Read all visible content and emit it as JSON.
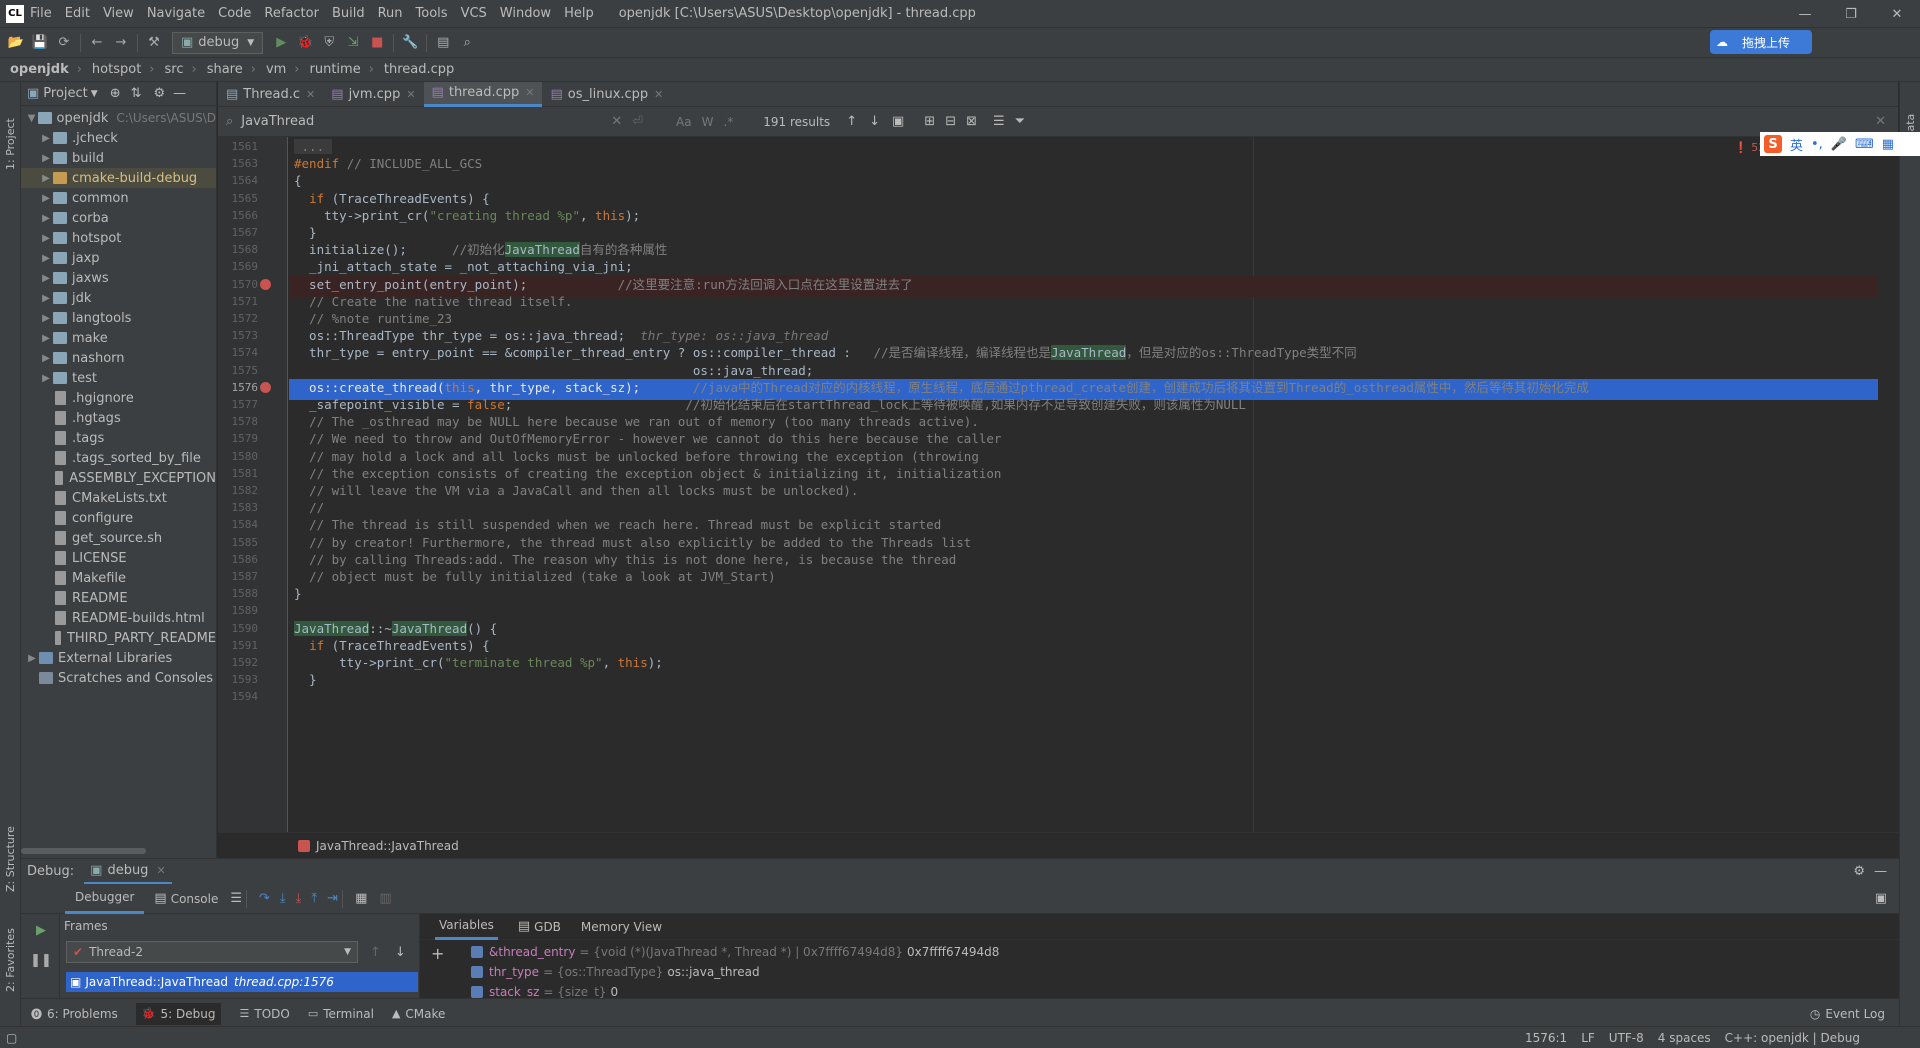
{
  "app": {
    "logo": "CL",
    "title": "openjdk [C:\\Users\\ASUS\\Desktop\\openjdk] - thread.cpp"
  },
  "menu": [
    "File",
    "Edit",
    "View",
    "Navigate",
    "Code",
    "Refactor",
    "Build",
    "Run",
    "Tools",
    "VCS",
    "Window",
    "Help"
  ],
  "toolbar": {
    "config": "debug"
  },
  "baidu": {
    "label": "拖拽上传"
  },
  "breadcrumb": [
    "openjdk",
    "hotspot",
    "src",
    "share",
    "vm",
    "runtime",
    "thread.cpp"
  ],
  "project": {
    "header": "Project",
    "root": {
      "name": "openjdk",
      "path": "C:\\Users\\ASUS\\D"
    },
    "items": [
      {
        "name": ".jcheck",
        "type": "folder"
      },
      {
        "name": "build",
        "type": "folder"
      },
      {
        "name": "cmake-build-debug",
        "type": "folder",
        "selected": true
      },
      {
        "name": "common",
        "type": "folder"
      },
      {
        "name": "corba",
        "type": "folder"
      },
      {
        "name": "hotspot",
        "type": "folder"
      },
      {
        "name": "jaxp",
        "type": "folder"
      },
      {
        "name": "jaxws",
        "type": "folder"
      },
      {
        "name": "jdk",
        "type": "folder"
      },
      {
        "name": "langtools",
        "type": "folder"
      },
      {
        "name": "make",
        "type": "folder"
      },
      {
        "name": "nashorn",
        "type": "folder"
      },
      {
        "name": "test",
        "type": "folder"
      },
      {
        "name": ".hgignore",
        "type": "file"
      },
      {
        "name": ".hgtags",
        "type": "file"
      },
      {
        "name": ".tags",
        "type": "file"
      },
      {
        "name": ".tags_sorted_by_file",
        "type": "file"
      },
      {
        "name": "ASSEMBLY_EXCEPTION",
        "type": "file"
      },
      {
        "name": "CMakeLists.txt",
        "type": "file"
      },
      {
        "name": "configure",
        "type": "file"
      },
      {
        "name": "get_source.sh",
        "type": "file"
      },
      {
        "name": "LICENSE",
        "type": "file"
      },
      {
        "name": "Makefile",
        "type": "file"
      },
      {
        "name": "README",
        "type": "file"
      },
      {
        "name": "README-builds.html",
        "type": "file"
      },
      {
        "name": "THIRD_PARTY_README",
        "type": "file"
      }
    ],
    "external": "External Libraries",
    "scratches": "Scratches and Consoles"
  },
  "tabs": [
    "Thread.c",
    "jvm.cpp",
    "thread.cpp",
    "os_linux.cpp"
  ],
  "active_tab": 2,
  "search": {
    "query": "JavaThread",
    "results": "191 results",
    "opt_case": "Aa",
    "opt_word": "W",
    "opt_regex": ".*"
  },
  "editor": {
    "errors": "52",
    "lines": [
      {
        "n": "1561",
        "html": "<span class='cm' style='background:#3b3b3b'> ... </span>"
      },
      {
        "n": "1563",
        "html": "<span class='kw'>#endif</span> <span class='cm'>// INCLUDE_ALL_GCS</span>"
      },
      {
        "n": "1564",
        "html": "{"
      },
      {
        "n": "1565",
        "html": "  <span class='kw'>if</span> (TraceThreadEvents) {"
      },
      {
        "n": "1566",
        "html": "    tty-&gt;print_cr(<span class='str'>\"creating thread %p\"</span>, <span class='kw'>this</span>);"
      },
      {
        "n": "1567",
        "html": "  }"
      },
      {
        "n": "1568",
        "html": "  initialize();      <span class='cm'>//初始化<span class='hl'>JavaThread</span>自有的各种属性</span>"
      },
      {
        "n": "1569",
        "html": "  _jni_attach_state = _not_attaching_via_jni;"
      },
      {
        "n": "1570",
        "html": "  set_entry_point(entry_point);            <span class='cm'>//这里要注意:run方法回调入口点在这里设置进去了</span>",
        "bp": true,
        "band": "#3a2323"
      },
      {
        "n": "1571",
        "html": "  <span class='cm'>// Create the native thread itself.</span>"
      },
      {
        "n": "1572",
        "html": "  <span class='cm'>// %note runtime_23</span>"
      },
      {
        "n": "1573",
        "html": "  os::ThreadType thr_type = os::java_thread;  <span class='hint'>thr_type: os::java_thread</span>"
      },
      {
        "n": "1574",
        "html": "  thr_type = entry_point == &amp;compiler_thread_entry ? os::compiler_thread :   <span class='cm'>//是否编译线程，编译线程也是<span class='hl'>JavaThread</span>，但是对应的os::ThreadType类型不同</span>"
      },
      {
        "n": "1575",
        "html": "                                                     os::java_thread;"
      },
      {
        "n": "1576",
        "html": "  os::create_thread(<span class='kw'>this</span>, thr_type, stack_sz);       <span class='cm'>//java中的Thread对应的内核线程，原生线程，底层通过pthread_create创建，创建成功后将其设置到Thread的_osthread属性中，然后等待其初始化完成</span>",
        "bp": true,
        "band": "#2f65ca"
      },
      {
        "n": "1577",
        "html": "  _safepoint_visible = <span class='kw'>false</span>;                       <span class='cm'>//初始化结束后在startThread_lock上等待被唤醒,如果内存不足导致创建失败，则该属性为NULL</span>"
      },
      {
        "n": "1578",
        "html": "  <span class='cm'>// The _osthread may be NULL here because we ran out of memory (too many threads active).</span>"
      },
      {
        "n": "1579",
        "html": "  <span class='cm'>// We need to throw and OutOfMemoryError - however we cannot do this here because the caller</span>"
      },
      {
        "n": "1580",
        "html": "  <span class='cm'>// may hold a lock and all locks must be unlocked before throwing the exception (throwing</span>"
      },
      {
        "n": "1581",
        "html": "  <span class='cm'>// the exception consists of creating the exception object &amp; initializing it, initialization</span>"
      },
      {
        "n": "1582",
        "html": "  <span class='cm'>// will leave the VM via a JavaCall and then all locks must be unlocked).</span>"
      },
      {
        "n": "1583",
        "html": "  <span class='cm'>//</span>"
      },
      {
        "n": "1584",
        "html": "  <span class='cm'>// The thread is still suspended when we reach here. Thread must be explicit started</span>"
      },
      {
        "n": "1585",
        "html": "  <span class='cm'>// by creator! Furthermore, the thread must also explicitly be added to the Threads list</span>"
      },
      {
        "n": "1586",
        "html": "  <span class='cm'>// by calling Threads:add. The reason why this is not done here, is because the thread</span>"
      },
      {
        "n": "1587",
        "html": "  <span class='cm'>// object must be fully initialized (take a look at JVM_Start)</span>"
      },
      {
        "n": "1588",
        "html": "}"
      },
      {
        "n": "1589",
        "html": ""
      },
      {
        "n": "1590",
        "html": "<span class='hl'>JavaThread</span>::~<span class='hl'>JavaThread</span>() {"
      },
      {
        "n": "1591",
        "html": "  <span class='kw'>if</span> (TraceThreadEvents) {"
      },
      {
        "n": "1592",
        "html": "      tty-&gt;print_cr(<span class='str'>\"terminate thread %p\"</span>, <span class='kw'>this</span>);"
      },
      {
        "n": "1593",
        "html": "  }"
      },
      {
        "n": "1594",
        "html": ""
      }
    ]
  },
  "code_crumb": "JavaThread::JavaThread",
  "debug": {
    "label": "Debug:",
    "config": "debug",
    "tabs": [
      "Debugger",
      "Console"
    ],
    "frames_label": "Frames",
    "thread": "Thread-2",
    "frame": {
      "method": "JavaThread::JavaThread",
      "loc": "thread.cpp:1576"
    },
    "var_tabs": [
      "Variables",
      "GDB",
      "Memory View"
    ],
    "variables": [
      {
        "name": "&thread_entry",
        "type": "= {void (*)(JavaThread *, Thread *) | 0x7ffff67494d8}",
        "value": "0x7ffff67494d8"
      },
      {
        "name": "thr_type",
        "type": "= {os::ThreadType}",
        "value": "os::java_thread"
      },
      {
        "name": "stack_sz",
        "type": "= {size_t}",
        "value": "0"
      }
    ]
  },
  "bottom_tabs": [
    "6: Problems",
    "5: Debug",
    "TODO",
    "Terminal",
    "CMake"
  ],
  "event_log": "Event Log",
  "status": [
    "1576:1",
    "LF",
    "UTF-8",
    "4 spaces",
    "C++: openjdk | Debug"
  ],
  "side": {
    "project": "1: Project",
    "structure": "Z: Structure",
    "favorites": "2: Favorites",
    "database": "Data"
  },
  "ime": {
    "lang": "英"
  }
}
